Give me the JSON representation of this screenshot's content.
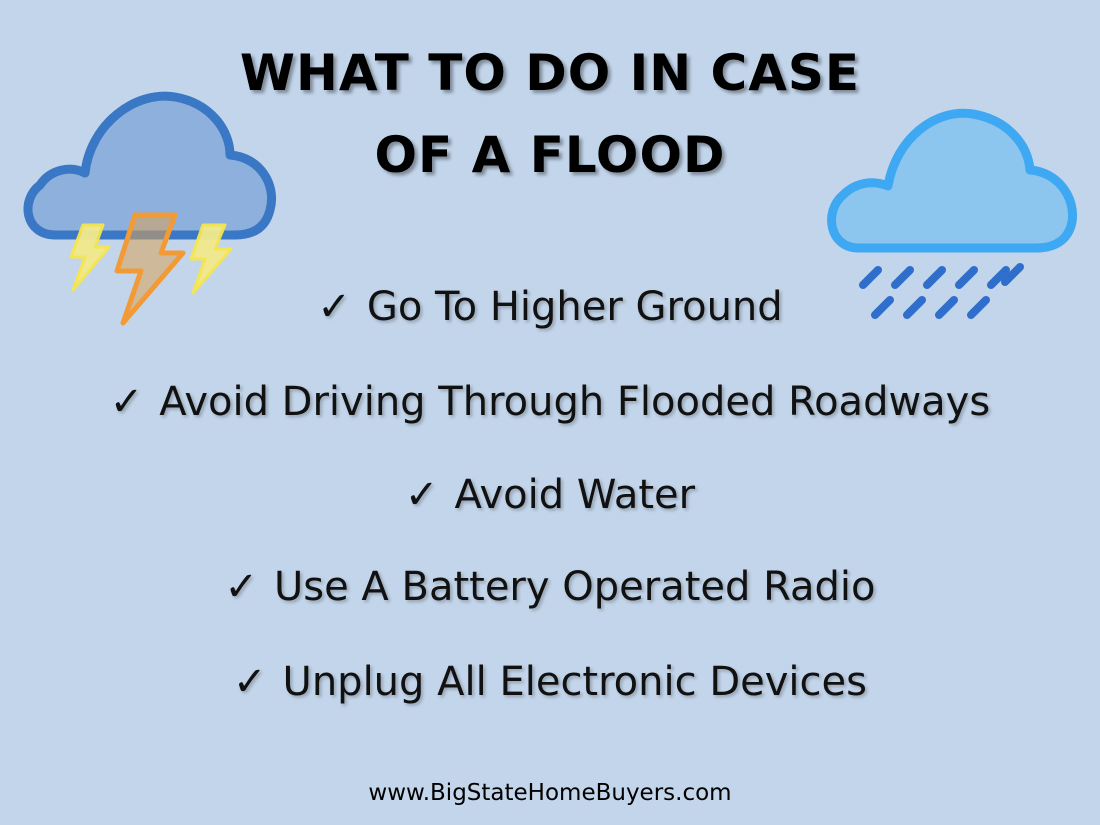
{
  "title": {
    "line1": "WHAT TO DO IN CASE",
    "line2": "OF A FLOOD"
  },
  "check_glyph": "✓",
  "items": [
    "Go To Higher Ground",
    "Avoid Driving Through Flooded Roadways",
    "Avoid Water",
    "Use A Battery Operated Radio",
    "Unplug All Electronic Devices"
  ],
  "footer": "www.BigStateHomeBuyers.com",
  "icons": {
    "left": "storm-cloud-lightning-icon",
    "right": "rain-cloud-icon"
  },
  "colors": {
    "background": "#c3d5ea",
    "storm_cloud_fill": "#8eb0dc",
    "storm_cloud_stroke": "#3a77c4",
    "rain_cloud_fill": "#8cc6ef",
    "rain_cloud_stroke": "#3ea8f2",
    "rain_drops": "#2f6fcb",
    "bolt_center": "#f29a35",
    "bolt_side": "#f7e64a"
  }
}
